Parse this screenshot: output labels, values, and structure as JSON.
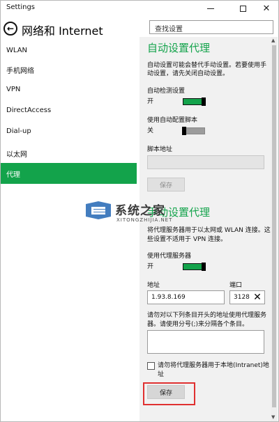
{
  "window": {
    "title": "Settings"
  },
  "header": {
    "title": "网络和 Internet",
    "search_placeholder": "查找设置"
  },
  "sidebar": {
    "items": [
      {
        "label": "WLAN"
      },
      {
        "label": "手机网络"
      },
      {
        "label": "VPN"
      },
      {
        "label": "DirectAccess"
      },
      {
        "label": "Dial-up"
      },
      {
        "label": "以太网"
      },
      {
        "label": "代理",
        "active": true
      }
    ]
  },
  "auto": {
    "heading": "自动设置代理",
    "desc_line1": "自动设置可能会替代手动设置。若要使用手",
    "desc_line2": "动设置，请先关闭自动设置。",
    "detect_label": "自动检测设置",
    "detect_state": "开",
    "script_label": "使用自动配置脚本",
    "script_state": "关",
    "address_label": "脚本地址",
    "save": "保存"
  },
  "manual": {
    "heading": "手动设置代理",
    "desc_line1": "将代理服务器用于以太网或 WLAN 连接。这",
    "desc_line2": "些设置不适用于 VPN 连接。",
    "use_label": "使用代理服务器",
    "use_state": "开",
    "address_label": "地址",
    "address_value": "1.93.8.169",
    "port_label": "端口",
    "port_value": "3128",
    "exceptions_line1": "请勿对以下列条目开头的地址使用代理服务",
    "exceptions_line2": "器。请使用分号(;)来分隔各个条目。",
    "local_line1": "请勿将代理服务器用于本地(Intranet)地",
    "local_line2": "址",
    "save": "保存"
  },
  "watermark": {
    "title": "系统之家",
    "subtitle": "XITONGZHIJIA.NET"
  },
  "colors": {
    "accent": "#13a34b",
    "highlight": "#e03030"
  }
}
